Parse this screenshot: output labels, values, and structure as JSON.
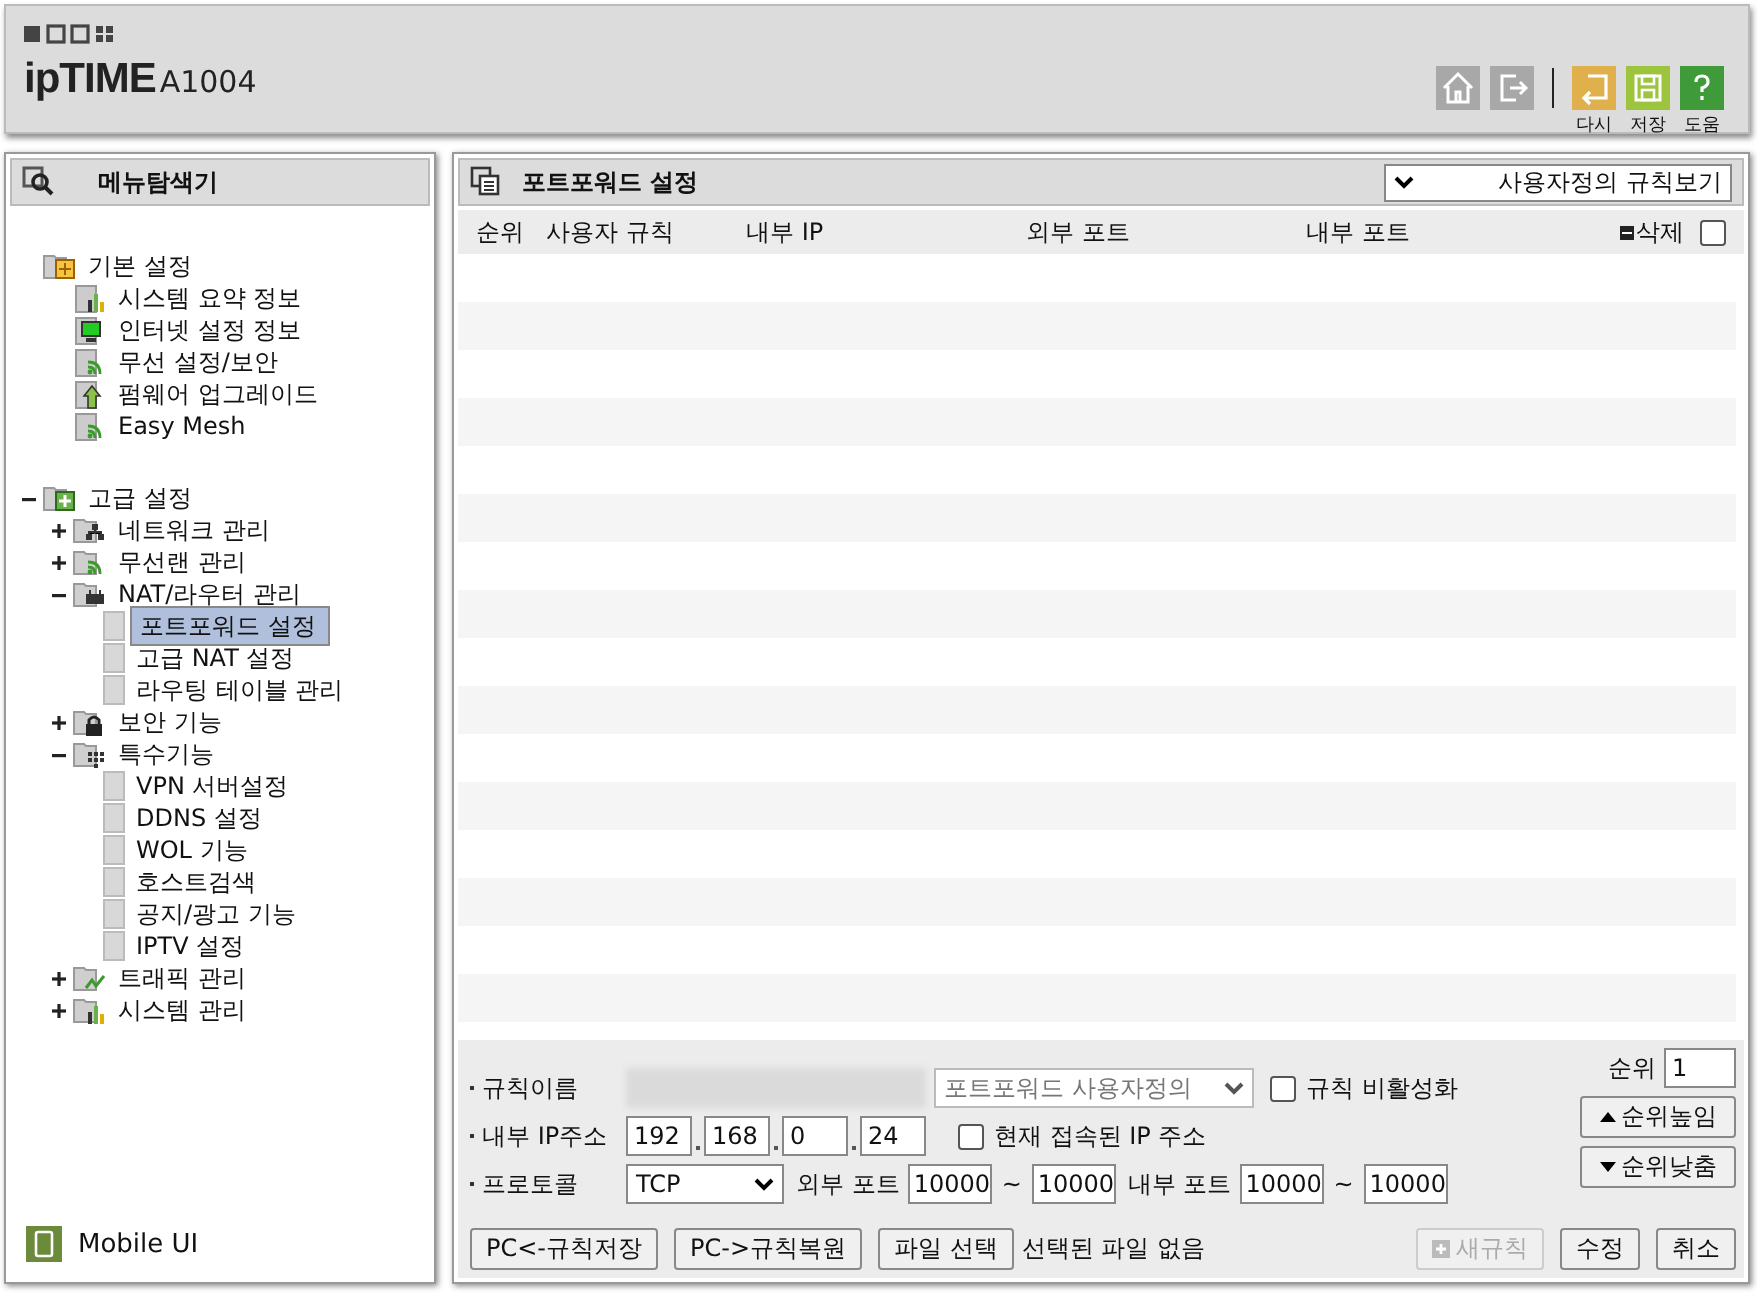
{
  "header": {
    "brand": "ipTIME",
    "model": "A1004",
    "actions": [
      {
        "kind": "home"
      },
      {
        "kind": "logout"
      },
      {
        "kind": "reload",
        "label": "다시"
      },
      {
        "kind": "save",
        "label": "저장"
      },
      {
        "kind": "help",
        "label": "도움"
      }
    ]
  },
  "sidebar": {
    "title": "메뉴탐색기",
    "tree": [
      {
        "label": "기본 설정",
        "kind": "basic-folder",
        "children": [
          {
            "label": "시스템 요약 정보",
            "kind": "chart",
            "selected": false
          },
          {
            "label": "인터넷 설정 정보",
            "kind": "monitor",
            "selected": false
          },
          {
            "label": "무선 설정/보안",
            "kind": "wifi",
            "selected": false
          },
          {
            "label": "펌웨어 업그레이드",
            "kind": "upgrade",
            "selected": false
          },
          {
            "label": "Easy Mesh",
            "kind": "wifi",
            "selected": false
          }
        ]
      },
      {
        "label": "고급 설정",
        "kind": "advanced-folder",
        "expanded": true,
        "children": [
          {
            "label": "네트워크 관리",
            "kind": "network-folder",
            "expanded": false
          },
          {
            "label": "무선랜 관리",
            "kind": "wifi-folder",
            "expanded": false
          },
          {
            "label": "NAT/라우터 관리",
            "kind": "router-folder",
            "expanded": true,
            "children": [
              {
                "label": "포트포워드 설정",
                "kind": "page",
                "selected": true
              },
              {
                "label": "고급 NAT 설정",
                "kind": "page",
                "selected": false
              },
              {
                "label": "라우팅 테이블 관리",
                "kind": "page",
                "selected": false
              }
            ]
          },
          {
            "label": "보안 기능",
            "kind": "lock-folder",
            "expanded": false
          },
          {
            "label": "특수기능",
            "kind": "grid-folder",
            "expanded": true,
            "children": [
              {
                "label": "VPN 서버설정",
                "kind": "page",
                "selected": false
              },
              {
                "label": "DDNS 설정",
                "kind": "page",
                "selected": false
              },
              {
                "label": "WOL 기능",
                "kind": "page",
                "selected": false
              },
              {
                "label": "호스트검색",
                "kind": "page",
                "selected": false
              },
              {
                "label": "공지/광고 기능",
                "kind": "page",
                "selected": false
              },
              {
                "label": "IPTV 설정",
                "kind": "page",
                "selected": false
              }
            ]
          },
          {
            "label": "트래픽 관리",
            "kind": "traffic-folder",
            "expanded": false
          },
          {
            "label": "시스템 관리",
            "kind": "chart-folder",
            "expanded": false
          }
        ]
      }
    ],
    "mobile_link": "Mobile UI"
  },
  "panel": {
    "title": "포트포워드 설정",
    "view_select": "사용자정의 규칙보기",
    "columns": [
      "순위",
      "사용자 규칙",
      "내부 IP",
      "외부 포트",
      "내부 포트"
    ],
    "delete_label": "삭제",
    "select_all": {
      "checked": false
    },
    "form": {
      "name_label": "규칙이름",
      "preset": "포트포워드 사용자정의",
      "disable_rule": {
        "label": "규칙 비활성화",
        "checked": false
      },
      "ip_label": "내부 IP주소",
      "ip": [
        "192",
        "168",
        "0",
        "24"
      ],
      "current_ip": {
        "label": "현재 접속된 IP 주소",
        "checked": false
      },
      "protocol_label": "프로토콜",
      "protocol": "TCP",
      "ext_label": "외부 포트",
      "ext_from": "10000",
      "ext_to": "10000",
      "int_label": "내부 포트",
      "int_from": "10000",
      "int_to": "10000",
      "range_sep": "~",
      "rank_label": "순위",
      "rank": "1",
      "up": "순위높임",
      "down": "순위낮춤"
    },
    "footer": {
      "save": "PC<-규칙저장",
      "restore": "PC->규칙복원",
      "file_button": "파일 선택",
      "file_status": "선택된 파일 없음",
      "new_rule": {
        "label": "새규칙",
        "disabled": true
      },
      "edit": "수정",
      "cancel": "취소"
    }
  }
}
